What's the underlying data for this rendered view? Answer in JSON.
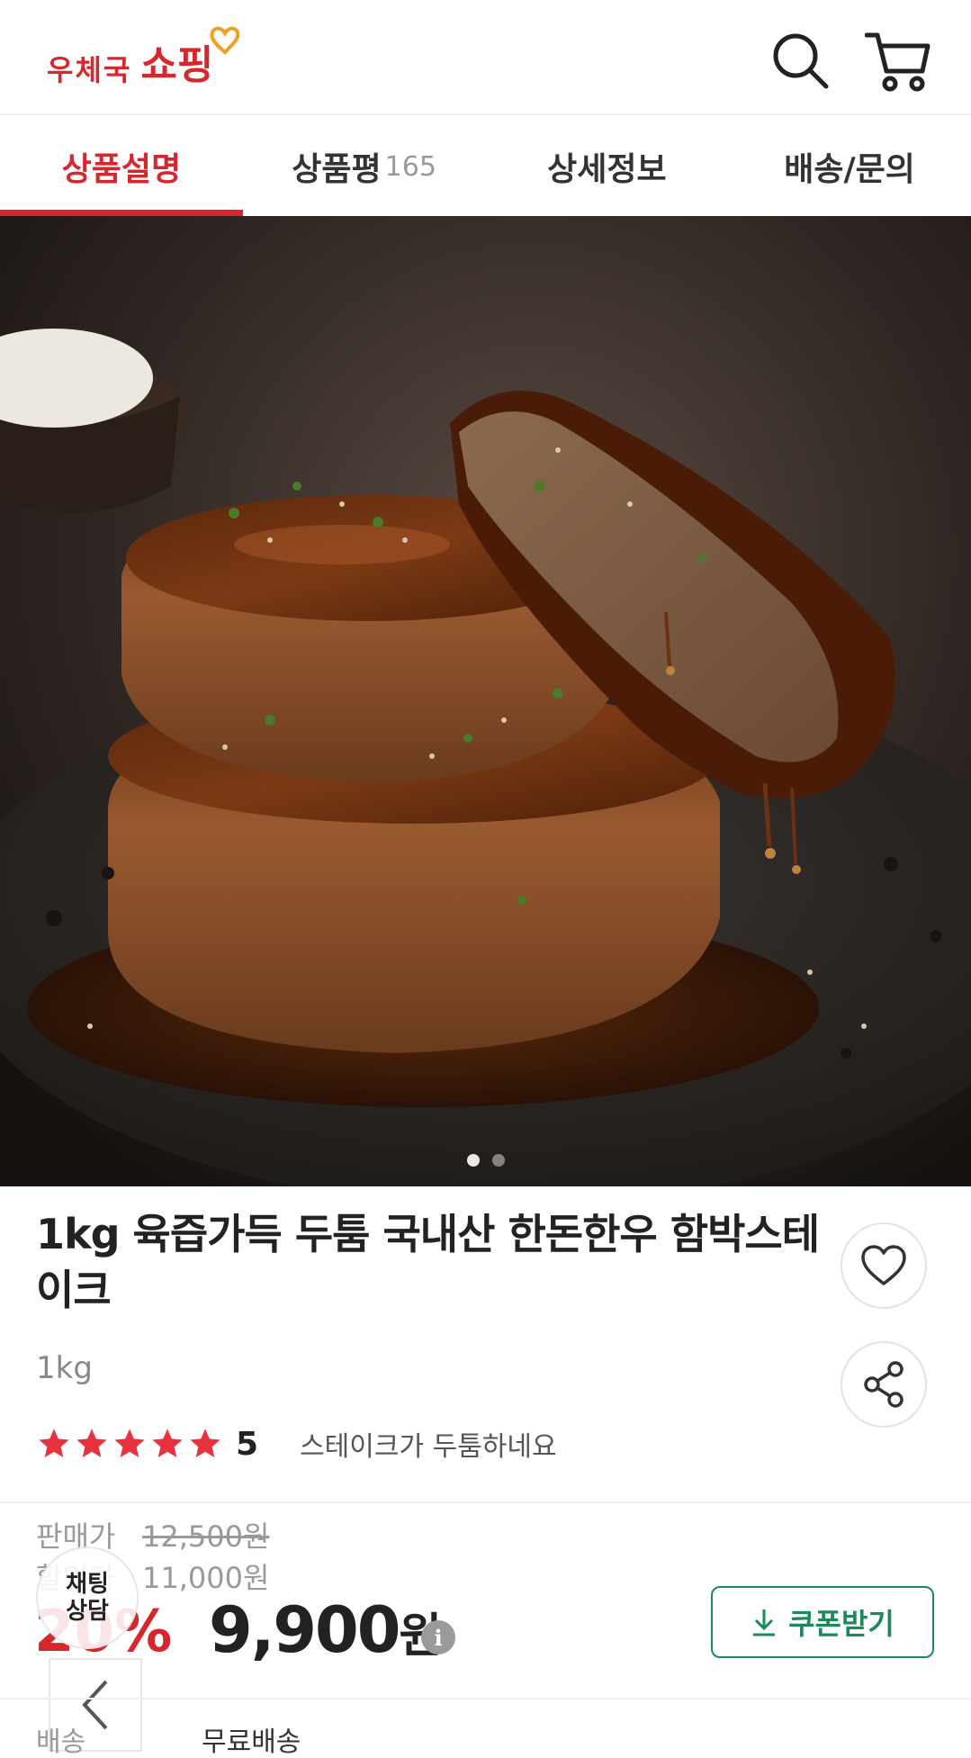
{
  "header": {
    "logo_small": "우체국",
    "logo_big": "쇼핑",
    "search_icon": "search-icon",
    "cart_icon": "cart-icon"
  },
  "tabs": [
    {
      "label": "상품설명",
      "count": "",
      "active": true
    },
    {
      "label": "상품평",
      "count": "165",
      "active": false
    },
    {
      "label": "상세정보",
      "count": "",
      "active": false
    },
    {
      "label": "배송/문의",
      "count": "",
      "active": false
    }
  ],
  "gallery": {
    "total": 2,
    "current": 1
  },
  "product": {
    "title": "1kg 육즙가득 두툼 국내산 한돈한우 함박스테이크",
    "option": "1kg",
    "rating": "5",
    "stars": 5,
    "review_snippet": "스테이크가 두툼하네요"
  },
  "price": {
    "sale_label": "판매가",
    "sale_value": "12,500원",
    "member_label": "할인가",
    "member_value": "11,000원",
    "discount": "20%",
    "final_amount": "9,900",
    "final_unit": "원",
    "info_icon": "i"
  },
  "coupon": {
    "label": "쿠폰받기",
    "icon": "download-icon"
  },
  "chat": {
    "line1": "채팅",
    "line2": "상담"
  },
  "shipping": {
    "label": "배송",
    "value": "무료배송"
  },
  "colors": {
    "brand": "#d7262c",
    "coupon": "#1b8a5a"
  }
}
